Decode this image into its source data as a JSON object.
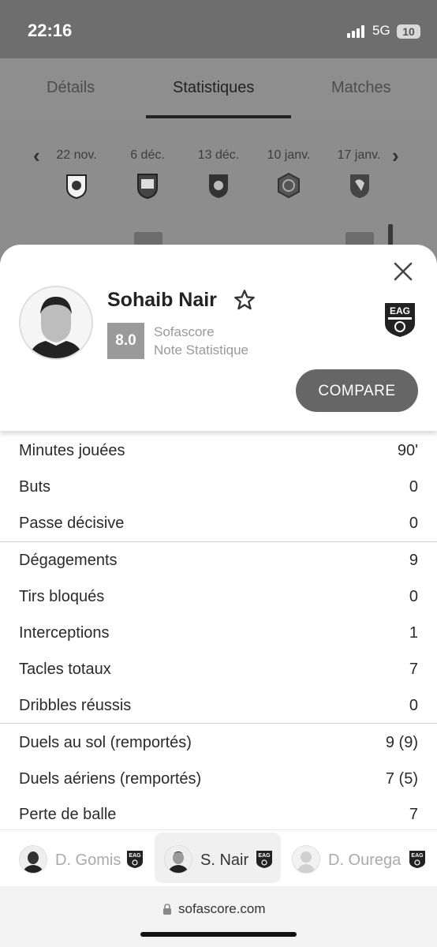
{
  "status": {
    "time": "22:16",
    "network": "5G",
    "battery": "10"
  },
  "tabs": [
    {
      "label": "Détails"
    },
    {
      "label": "Statistiques"
    },
    {
      "label": "Matches"
    }
  ],
  "matches": {
    "dates": [
      "22 nov.",
      "6 déc.",
      "13 déc.",
      "10 janv.",
      "17 janv."
    ],
    "crest_icons": [
      "club-crest-icon",
      "club-crest-icon",
      "club-crest-icon",
      "club-crest-icon",
      "club-crest-icon"
    ]
  },
  "player": {
    "name": "Sohaib Nair",
    "rating": "8.0",
    "rating_label_1": "Sofascore",
    "rating_label_2": "Note Statistique",
    "compare_label": "COMPARE",
    "team_crest": "EAG"
  },
  "stats": {
    "group1": [
      {
        "label": "Minutes jouées",
        "value": "90'"
      },
      {
        "label": "Buts",
        "value": "0"
      },
      {
        "label": "Passe décisive",
        "value": "0"
      }
    ],
    "group2": [
      {
        "label": "Dégagements",
        "value": "9"
      },
      {
        "label": "Tirs bloqués",
        "value": "0"
      },
      {
        "label": "Interceptions",
        "value": "1"
      },
      {
        "label": "Tacles totaux",
        "value": "7"
      },
      {
        "label": "Dribbles réussis",
        "value": "0"
      }
    ],
    "group3": [
      {
        "label": "Duels au sol (remportés)",
        "value": "9 (9)"
      },
      {
        "label": "Duels aériens (remportés)",
        "value": "7 (5)"
      },
      {
        "label": "Perte de balle",
        "value": "7"
      }
    ]
  },
  "player_tabs": [
    {
      "name": "D. Gomis",
      "crest": "EAG"
    },
    {
      "name": "S. Nair",
      "crest": "EAG"
    },
    {
      "name": "D. Ourega",
      "crest": "EAG"
    }
  ],
  "browser": {
    "url": "sofascore.com"
  },
  "colors": {
    "accent_button": "#666666",
    "rating_box": "#9a9a9a"
  }
}
